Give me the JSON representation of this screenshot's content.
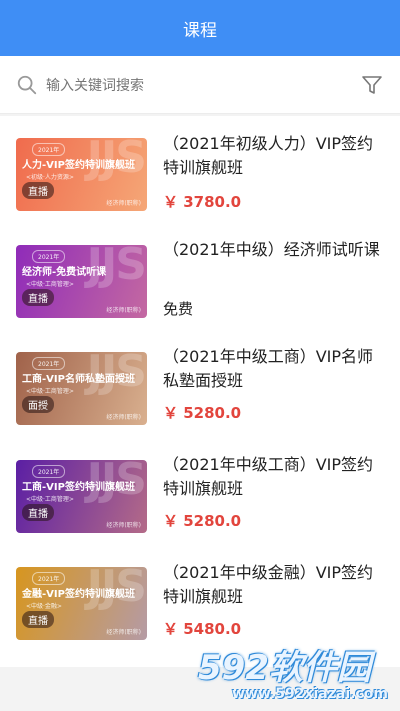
{
  "header": {
    "title": "课程"
  },
  "search": {
    "placeholder": "输入关键词搜索"
  },
  "courses": [
    {
      "thumb_year": "2021年",
      "thumb_title": "人力-VIP签约特训旗舰班",
      "thumb_sub": "<初级·人力资源>",
      "thumb_tag": "直播",
      "thumb_corner": "经济师(职称)",
      "thumb_watermark": "JJS",
      "title": "（2021年初级人力）VIP签约特训旗舰班",
      "price": "￥ 3780.0"
    },
    {
      "thumb_year": "2021年",
      "thumb_title": "经济师-免费试听课",
      "thumb_sub": "<中级·工商管理>",
      "thumb_tag": "直播",
      "thumb_corner": "经济师(职称)",
      "thumb_watermark": "JJS",
      "title": "（2021年中级）经济师试听课",
      "price": "免费"
    },
    {
      "thumb_year": "2021年",
      "thumb_title": "工商-VIP名师私塾面授班",
      "thumb_sub": "<中级·工商管理>",
      "thumb_tag": "面授",
      "thumb_corner": "经济师(职称)",
      "thumb_watermark": "JJS",
      "title": "（2021年中级工商）VIP名师私塾面授班",
      "price": "￥ 5280.0"
    },
    {
      "thumb_year": "2021年",
      "thumb_title": "工商-VIP签约特训旗舰班",
      "thumb_sub": "<中级·工商管理>",
      "thumb_tag": "直播",
      "thumb_corner": "经济师(职称)",
      "thumb_watermark": "JJS",
      "title": "（2021年中级工商）VIP签约特训旗舰班",
      "price": "￥ 5280.0"
    },
    {
      "thumb_year": "2021年",
      "thumb_title": "金融-VIP签约特训旗舰班",
      "thumb_sub": "<中级·金融>",
      "thumb_tag": "直播",
      "thumb_corner": "经济师(职称)",
      "thumb_watermark": "JJS",
      "title": "（2021年中级金融）VIP签约特训旗舰班",
      "price": "￥ 5480.0"
    }
  ],
  "watermark": {
    "brand": "592软件园",
    "url": "www.592xiazai.com"
  },
  "colors": {
    "header": "#3f8ef5",
    "price": "#e2453d"
  }
}
